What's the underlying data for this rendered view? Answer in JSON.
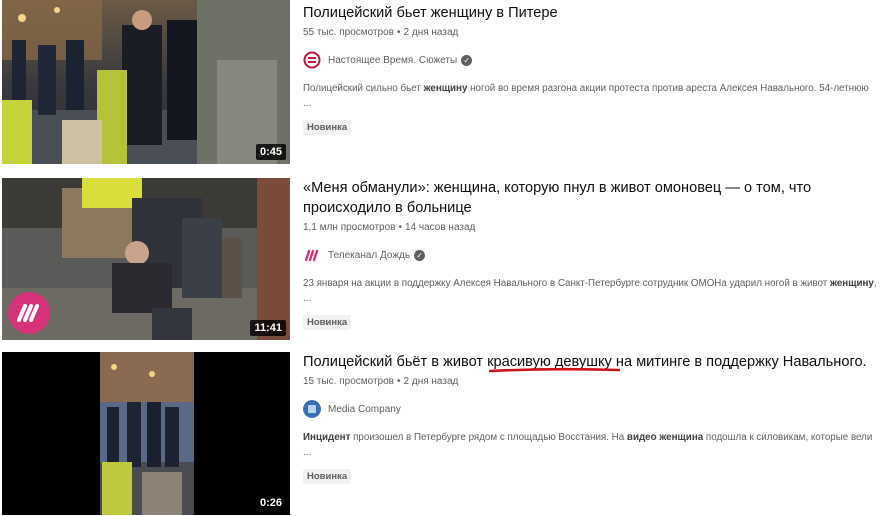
{
  "results": [
    {
      "title": "Полицейский бьет женщину в Питере",
      "views": "55 тыс. просмотров",
      "age": "2 дня назад",
      "channel": "Настоящее Время. Сюжеты",
      "verified": true,
      "desc_parts": [
        "Полицейский сильно бьет ",
        "женщину",
        " ногой во время разгона акции протеста против ареста Алексея Навального. 54-летнюю ..."
      ],
      "badge": "Новинка",
      "duration": "0:45"
    },
    {
      "title": "«Меня обманули»: женщина, которую пнул в живот омоновец — о том, что происходило в больнице",
      "views": "1,1 млн просмотров",
      "age": "14 часов назад",
      "channel": "Телеканал Дождь",
      "verified": true,
      "desc_parts": [
        "23 января на акции в поддержку Алексея Навального в Санкт-Петербурге сотрудник ОМОНа ударил ногой в живот ",
        "женщину",
        ", ..."
      ],
      "badge": "Новинка",
      "duration": "11:41"
    },
    {
      "title": "Полицейский бьёт в живот красивую девушку на митинге в поддержку Навального.",
      "views": "15 тыс. просмотров",
      "age": "2 дня назад",
      "channel": "Media Company",
      "verified": false,
      "desc_parts": [
        "Инцидент",
        " произошел в Петербурге рядом с площадью Восстания. На ",
        "видео",
        " ",
        "женщина",
        " подошла к силовикам, которые вели ..."
      ],
      "badge": "Новинка",
      "duration": "0:26"
    }
  ],
  "colors": {
    "underline": "#d0121b",
    "dozhd": "#d6337a",
    "nastoyashee": "#c3163b",
    "media_company": "#3a6fb5"
  }
}
